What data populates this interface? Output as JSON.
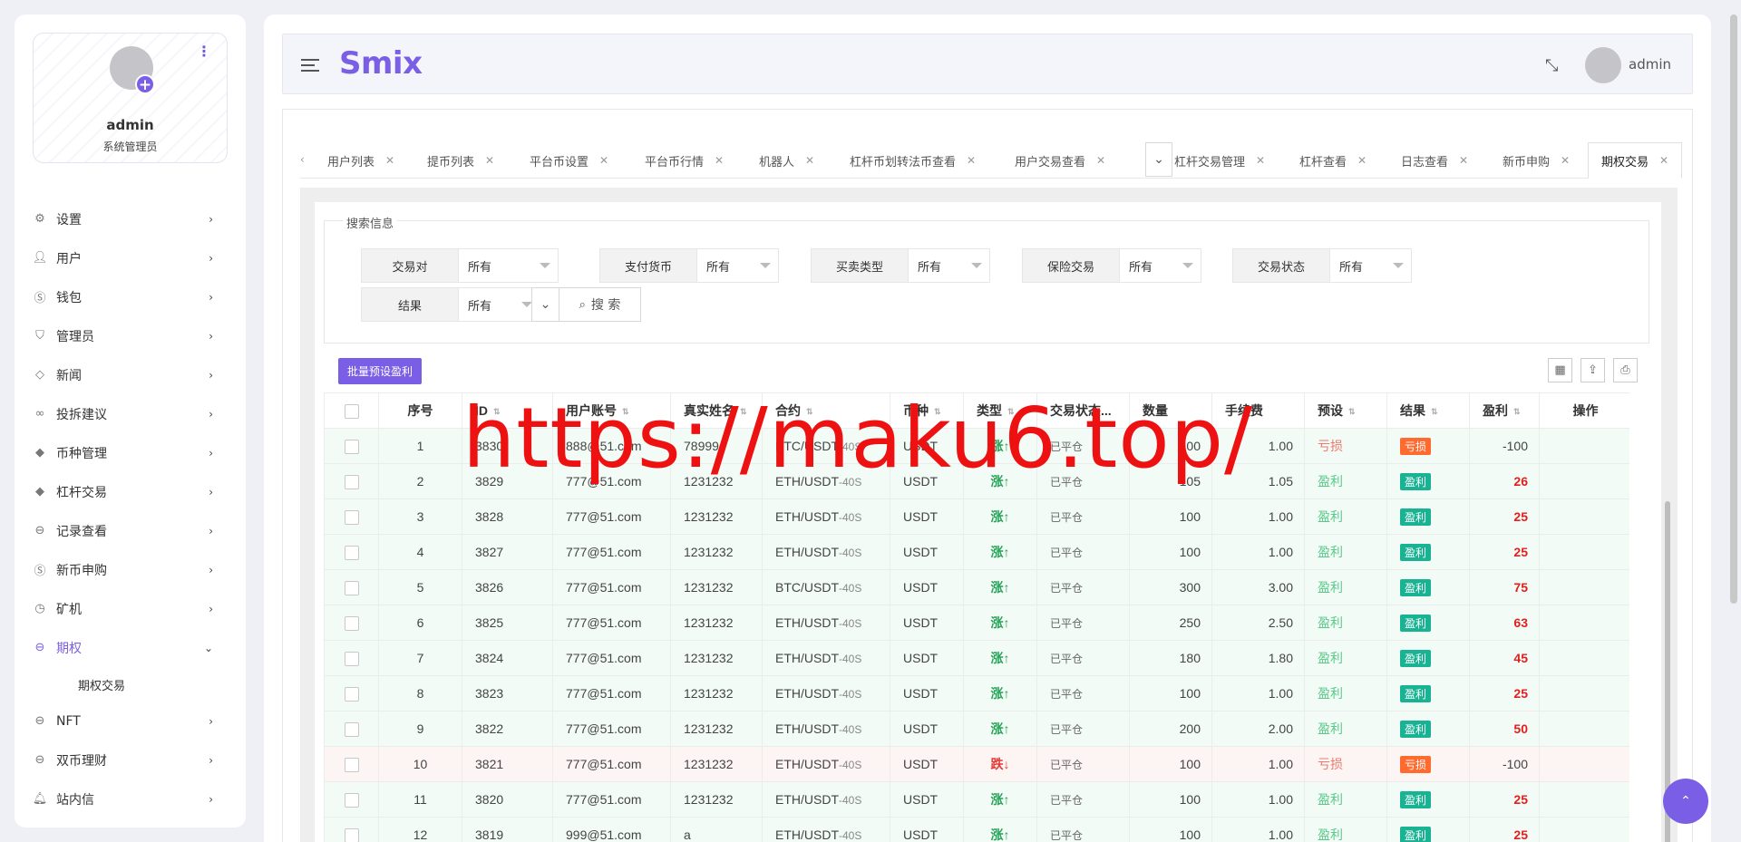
{
  "sidebar": {
    "profile": {
      "name": "admin",
      "role": "系统管理员"
    },
    "menu": [
      {
        "label": "设置",
        "icon": "gear-icon"
      },
      {
        "label": "用户",
        "icon": "user-icon"
      },
      {
        "label": "钱包",
        "icon": "dollar-icon"
      },
      {
        "label": "管理员",
        "icon": "shield-icon"
      },
      {
        "label": "新闻",
        "icon": "tag-icon"
      },
      {
        "label": "投拆建议",
        "icon": "infinity-icon"
      },
      {
        "label": "币种管理",
        "icon": "diamond-icon"
      },
      {
        "label": "杠杆交易",
        "icon": "diamond-icon"
      },
      {
        "label": "记录查看",
        "icon": "coin-icon"
      },
      {
        "label": "新币申购",
        "icon": "dollar-icon"
      },
      {
        "label": "矿机",
        "icon": "clock-icon"
      },
      {
        "label": "期权",
        "icon": "coin-icon"
      },
      {
        "label": "NFT",
        "icon": "coin-icon"
      },
      {
        "label": "双币理财",
        "icon": "coin-icon"
      },
      {
        "label": "站内信",
        "icon": "bell-icon"
      }
    ],
    "submenu": {
      "label": "期权交易"
    }
  },
  "header": {
    "logo": "Smix",
    "user": "admin"
  },
  "tabs": [
    "用户列表",
    "提币列表",
    "平台币设置",
    "平台币行情",
    "机器人",
    "杠杆币划转法币查看",
    "用户交易查看",
    "杠杆交易管理",
    "杠杆查看",
    "日志查看",
    "新币申购",
    "期权交易"
  ],
  "search": {
    "legend": "搜索信息",
    "filters": [
      {
        "label": "交易对",
        "value": "所有"
      },
      {
        "label": "支付货币",
        "value": "所有"
      },
      {
        "label": "买卖类型",
        "value": "所有"
      },
      {
        "label": "保险交易",
        "value": "所有"
      },
      {
        "label": "交易状态",
        "value": "所有"
      },
      {
        "label": "结果",
        "value": "所有"
      }
    ],
    "button": "搜 索"
  },
  "toolbar": {
    "batch": "批量预设盈利"
  },
  "table": {
    "headers": [
      "序号",
      "ID",
      "用户账号",
      "真实姓名",
      "合约",
      "币种",
      "类型",
      "交易状态...",
      "数量",
      "手续费",
      "预设",
      "结果",
      "盈利",
      "操作"
    ],
    "rows": [
      {
        "no": "1",
        "id": "3830",
        "account": "888@51.com",
        "name": "78999",
        "pair": "BTC/USDT",
        "sfx": "-40S",
        "coin": "USDT",
        "type": "涨↑",
        "status": "已平仓",
        "qty": "100",
        "fee": "1.00",
        "preset": "亏损",
        "result": "亏损",
        "profit": "-100",
        "dir": "up",
        "win": false
      },
      {
        "no": "2",
        "id": "3829",
        "account": "777@51.com",
        "name": "1231232",
        "pair": "ETH/USDT",
        "sfx": "-40S",
        "coin": "USDT",
        "type": "涨↑",
        "status": "已平仓",
        "qty": "105",
        "fee": "1.05",
        "preset": "盈利",
        "result": "盈利",
        "profit": "26",
        "dir": "up",
        "win": true
      },
      {
        "no": "3",
        "id": "3828",
        "account": "777@51.com",
        "name": "1231232",
        "pair": "ETH/USDT",
        "sfx": "-40S",
        "coin": "USDT",
        "type": "涨↑",
        "status": "已平仓",
        "qty": "100",
        "fee": "1.00",
        "preset": "盈利",
        "result": "盈利",
        "profit": "25",
        "dir": "up",
        "win": true
      },
      {
        "no": "4",
        "id": "3827",
        "account": "777@51.com",
        "name": "1231232",
        "pair": "ETH/USDT",
        "sfx": "-40S",
        "coin": "USDT",
        "type": "涨↑",
        "status": "已平仓",
        "qty": "100",
        "fee": "1.00",
        "preset": "盈利",
        "result": "盈利",
        "profit": "25",
        "dir": "up",
        "win": true
      },
      {
        "no": "5",
        "id": "3826",
        "account": "777@51.com",
        "name": "1231232",
        "pair": "BTC/USDT",
        "sfx": "-40S",
        "coin": "USDT",
        "type": "涨↑",
        "status": "已平仓",
        "qty": "300",
        "fee": "3.00",
        "preset": "盈利",
        "result": "盈利",
        "profit": "75",
        "dir": "up",
        "win": true
      },
      {
        "no": "6",
        "id": "3825",
        "account": "777@51.com",
        "name": "1231232",
        "pair": "ETH/USDT",
        "sfx": "-40S",
        "coin": "USDT",
        "type": "涨↑",
        "status": "已平仓",
        "qty": "250",
        "fee": "2.50",
        "preset": "盈利",
        "result": "盈利",
        "profit": "63",
        "dir": "up",
        "win": true
      },
      {
        "no": "7",
        "id": "3824",
        "account": "777@51.com",
        "name": "1231232",
        "pair": "ETH/USDT",
        "sfx": "-40S",
        "coin": "USDT",
        "type": "涨↑",
        "status": "已平仓",
        "qty": "180",
        "fee": "1.80",
        "preset": "盈利",
        "result": "盈利",
        "profit": "45",
        "dir": "up",
        "win": true
      },
      {
        "no": "8",
        "id": "3823",
        "account": "777@51.com",
        "name": "1231232",
        "pair": "ETH/USDT",
        "sfx": "-40S",
        "coin": "USDT",
        "type": "涨↑",
        "status": "已平仓",
        "qty": "100",
        "fee": "1.00",
        "preset": "盈利",
        "result": "盈利",
        "profit": "25",
        "dir": "up",
        "win": true
      },
      {
        "no": "9",
        "id": "3822",
        "account": "777@51.com",
        "name": "1231232",
        "pair": "ETH/USDT",
        "sfx": "-40S",
        "coin": "USDT",
        "type": "涨↑",
        "status": "已平仓",
        "qty": "200",
        "fee": "2.00",
        "preset": "盈利",
        "result": "盈利",
        "profit": "50",
        "dir": "up",
        "win": true
      },
      {
        "no": "10",
        "id": "3821",
        "account": "777@51.com",
        "name": "1231232",
        "pair": "ETH/USDT",
        "sfx": "-40S",
        "coin": "USDT",
        "type": "跌↓",
        "status": "已平仓",
        "qty": "100",
        "fee": "1.00",
        "preset": "亏损",
        "result": "亏损",
        "profit": "-100",
        "dir": "down",
        "win": false
      },
      {
        "no": "11",
        "id": "3820",
        "account": "777@51.com",
        "name": "1231232",
        "pair": "ETH/USDT",
        "sfx": "-40S",
        "coin": "USDT",
        "type": "涨↑",
        "status": "已平仓",
        "qty": "100",
        "fee": "1.00",
        "preset": "盈利",
        "result": "盈利",
        "profit": "25",
        "dir": "up",
        "win": true
      },
      {
        "no": "12",
        "id": "3819",
        "account": "999@51.com",
        "name": "a",
        "pair": "ETH/USDT",
        "sfx": "-40S",
        "coin": "USDT",
        "type": "涨↑",
        "status": "已平仓",
        "qty": "100",
        "fee": "1.00",
        "preset": "盈利",
        "result": "盈利",
        "profit": "25",
        "dir": "up",
        "win": true
      }
    ]
  },
  "watermark": "https://maku6.top/",
  "colors": {
    "accent": "#7b5ee6",
    "win": "#19b394",
    "loss": "#ff6a2e",
    "profit": "#e02020"
  }
}
